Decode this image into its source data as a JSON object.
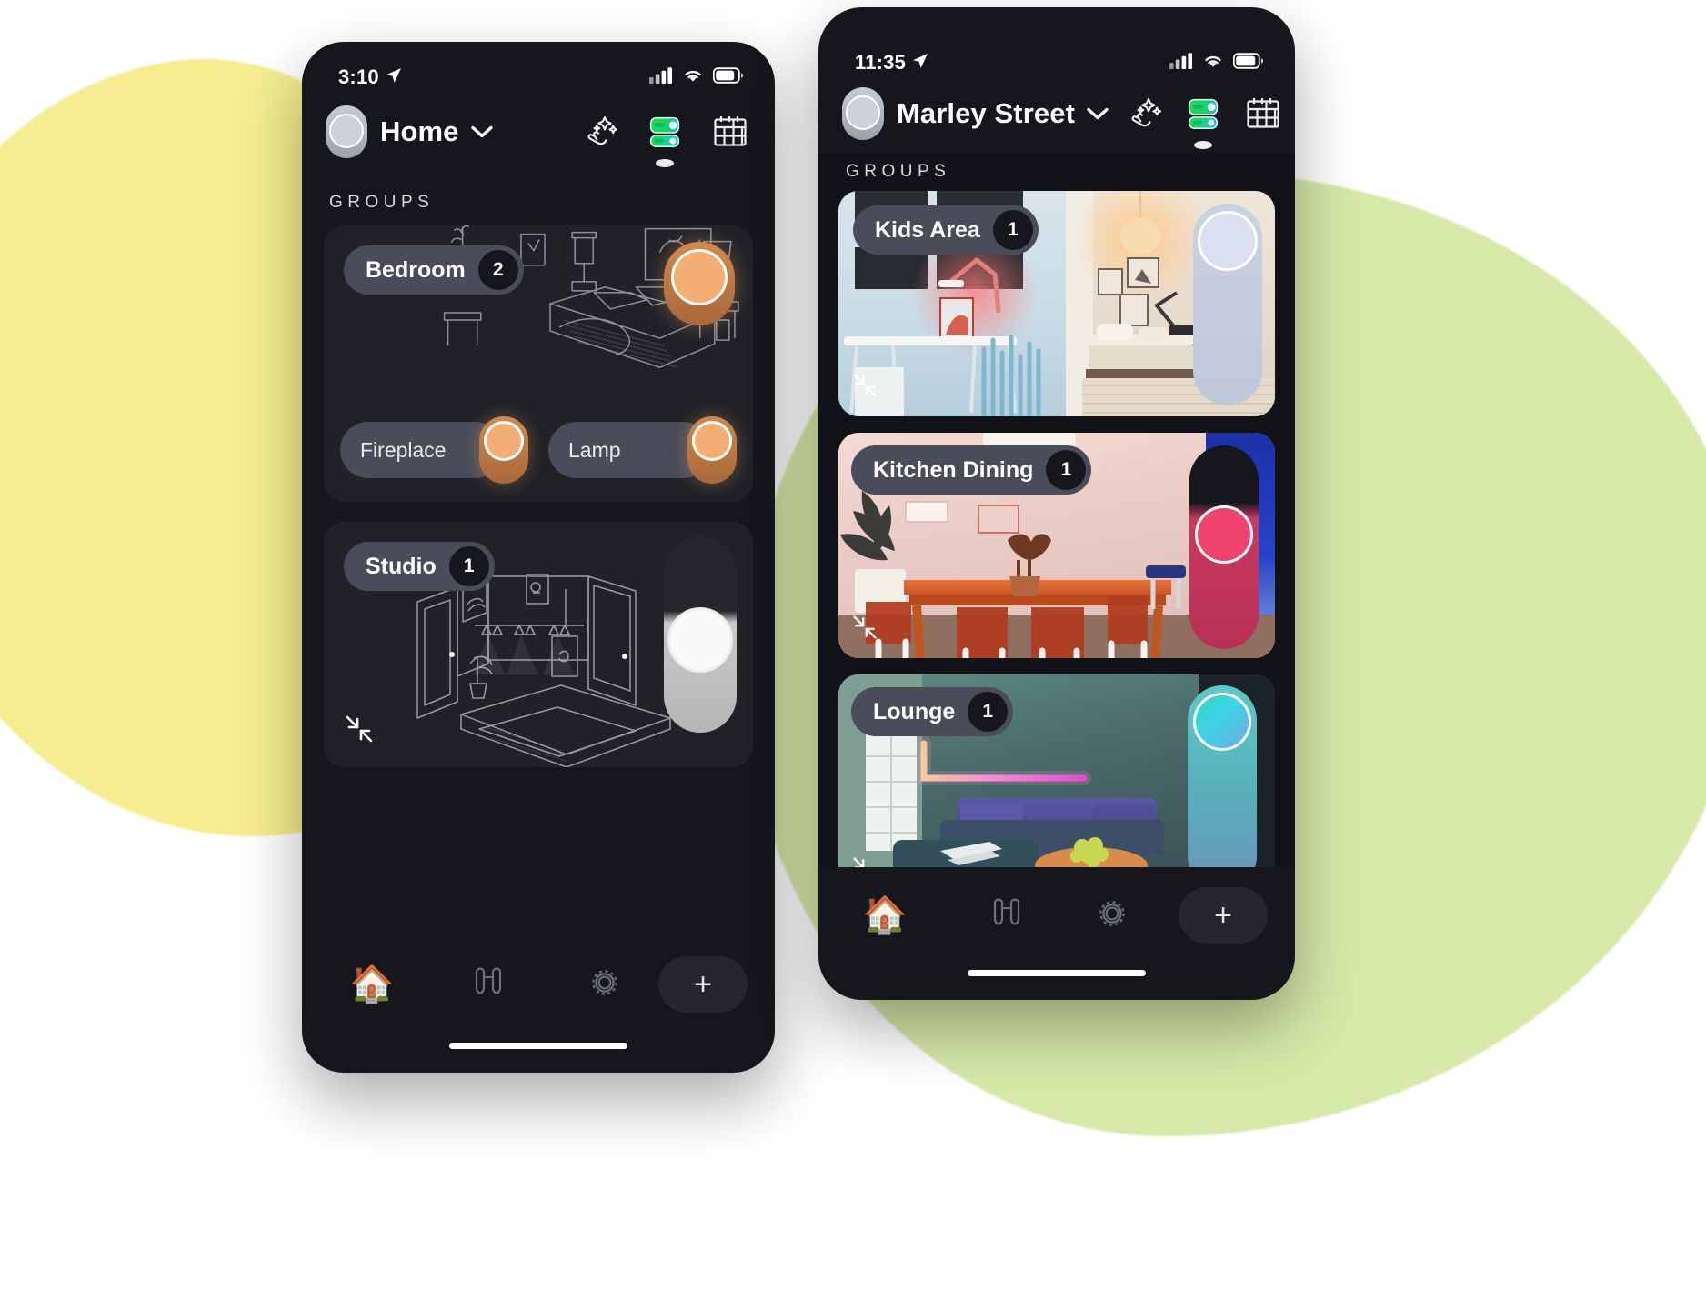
{
  "background": {
    "blob_yellow_color": "#F5ED8F",
    "blob_green_color": "#D6E9A8",
    "page_color": "#FFFFFF"
  },
  "phone_left": {
    "status_bar": {
      "time": "3:10",
      "location_icon": "location-arrow-icon",
      "cellular_icon": "cellular-signal-icon",
      "wifi_icon": "wifi-icon",
      "battery_icon": "battery-icon"
    },
    "header": {
      "avatar": "avatar",
      "title": "Home",
      "chevron": "⌄",
      "actions": [
        {
          "name": "magic-touch-icon",
          "label": "Scenes"
        },
        {
          "name": "toggles-icon",
          "label": "Devices"
        },
        {
          "name": "calendar-grid-icon",
          "label": "Schedules"
        }
      ]
    },
    "section_label": "GROUPS",
    "groups": [
      {
        "name": "Bedroom",
        "count": "2",
        "illustration": "bedroom-line-illustration",
        "devices": [
          {
            "name": "Fireplace",
            "toggle_color": "#F4AE73",
            "state": "on"
          },
          {
            "name": "Lamp",
            "toggle_color": "#F4AE73",
            "state": "on"
          }
        ]
      },
      {
        "name": "Studio",
        "count": "1",
        "illustration": "studio-line-illustration",
        "slider_color": "#FFFFFF",
        "slider_track": "#B8B8B8",
        "expand_icon": "collapse-arrows-icon",
        "devices": []
      }
    ],
    "tabbar": {
      "items": [
        {
          "name": "tab-home",
          "icon": "house-emoji-icon",
          "active": true
        },
        {
          "name": "tab-discover",
          "icon": "binoculars-icon",
          "active": false
        },
        {
          "name": "tab-settings",
          "icon": "gear-icon",
          "active": false
        }
      ],
      "add_label": "+"
    }
  },
  "phone_right": {
    "status_bar": {
      "time": "11:35",
      "location_icon": "location-arrow-icon",
      "cellular_icon": "cellular-signal-icon",
      "wifi_icon": "wifi-icon",
      "battery_icon": "battery-icon"
    },
    "header": {
      "avatar": "avatar",
      "title": "Marley Street",
      "chevron": "⌄",
      "actions": [
        {
          "name": "magic-touch-icon",
          "label": "Scenes"
        },
        {
          "name": "toggles-icon",
          "label": "Devices"
        },
        {
          "name": "calendar-grid-icon",
          "label": "Schedules"
        }
      ]
    },
    "section_label": "GROUPS",
    "groups": [
      {
        "name": "Kids Area",
        "count": "1",
        "photo": "kids-room-photo",
        "slider_color": "#D7DDF0",
        "slider_track": "#C4CBD8",
        "expand_icon": "collapse-arrows-icon"
      },
      {
        "name": "Kitchen Dining",
        "count": "1",
        "photo": "kitchen-dining-photo",
        "slider_color": "#F0436E",
        "slider_track": "#B93055",
        "expand_icon": "collapse-arrows-icon"
      },
      {
        "name": "Lounge",
        "count": "1",
        "photo": "lounge-photo",
        "slider_color": "#3FD9D2",
        "slider_track": "#7FB7C8",
        "expand_icon": "collapse-arrows-icon"
      }
    ],
    "tabbar": {
      "items": [
        {
          "name": "tab-home",
          "icon": "house-emoji-icon",
          "active": true
        },
        {
          "name": "tab-discover",
          "icon": "binoculars-icon",
          "active": false
        },
        {
          "name": "tab-settings",
          "icon": "gear-icon",
          "active": false
        }
      ],
      "add_label": "+"
    }
  }
}
